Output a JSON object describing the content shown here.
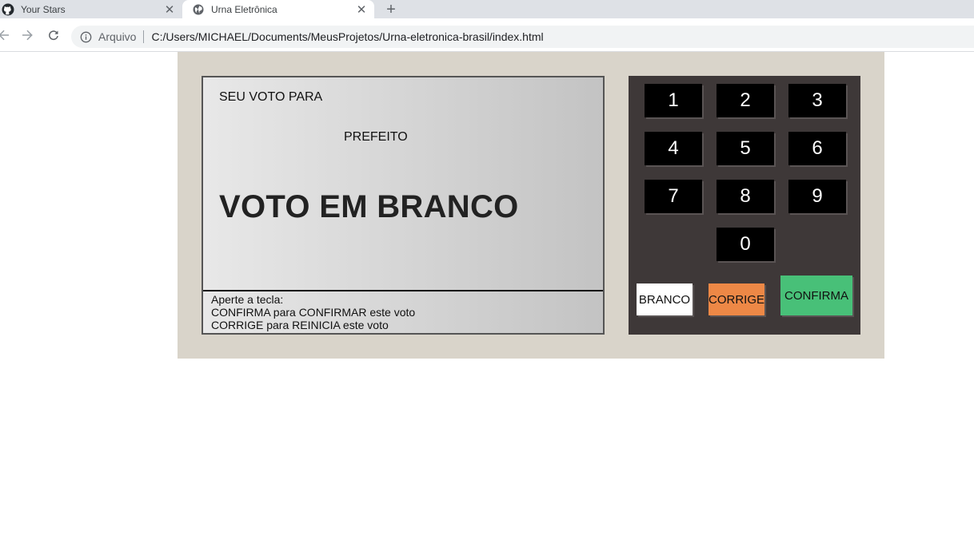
{
  "browser": {
    "tabs": [
      {
        "title": "Your Stars",
        "icon": "github-icon",
        "active": false
      },
      {
        "title": "Urna Eletrônica",
        "icon": "globe-icon",
        "active": true
      }
    ],
    "address": {
      "chip": "Arquivo",
      "url": "C:/Users/MICHAEL/Documents/MeusProjetos/Urna-eletronica-brasil/index.html"
    }
  },
  "tela": {
    "seu_voto": "SEU VOTO PARA",
    "cargo": "PREFEITO",
    "aviso": "VOTO EM BRANCO",
    "instrucoes": [
      "Aperte a tecla:",
      "CONFIRMA para CONFIRMAR este voto",
      "CORRIGE para REINICIA este voto"
    ]
  },
  "teclado": {
    "keys": [
      "1",
      "2",
      "3",
      "4",
      "5",
      "6",
      "7",
      "8",
      "9",
      "0"
    ],
    "branco": "BRANCO",
    "corrige": "CORRIGE",
    "confirma": "CONFIRMA"
  },
  "colors": {
    "branco": "#ffffff",
    "corrige": "#ed8846",
    "confirma": "#48c078",
    "keypad": "#3e3838",
    "cabinet": "#d9d4ca"
  }
}
